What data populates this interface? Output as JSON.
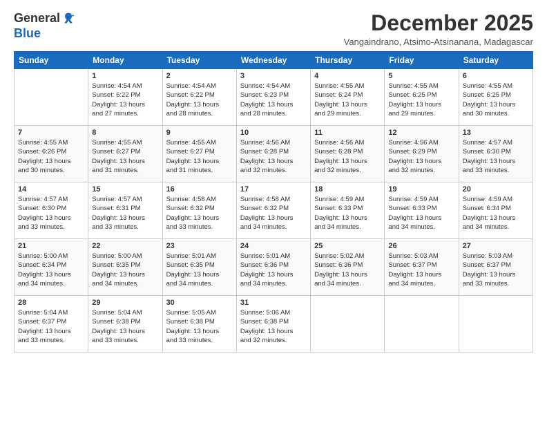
{
  "header": {
    "logo_line1": "General",
    "logo_line2": "Blue",
    "month": "December 2025",
    "location": "Vangaindrano, Atsimo-Atsinanana, Madagascar"
  },
  "days_of_week": [
    "Sunday",
    "Monday",
    "Tuesday",
    "Wednesday",
    "Thursday",
    "Friday",
    "Saturday"
  ],
  "weeks": [
    [
      {
        "num": "",
        "detail": ""
      },
      {
        "num": "1",
        "detail": "Sunrise: 4:54 AM\nSunset: 6:22 PM\nDaylight: 13 hours\nand 27 minutes."
      },
      {
        "num": "2",
        "detail": "Sunrise: 4:54 AM\nSunset: 6:22 PM\nDaylight: 13 hours\nand 28 minutes."
      },
      {
        "num": "3",
        "detail": "Sunrise: 4:54 AM\nSunset: 6:23 PM\nDaylight: 13 hours\nand 28 minutes."
      },
      {
        "num": "4",
        "detail": "Sunrise: 4:55 AM\nSunset: 6:24 PM\nDaylight: 13 hours\nand 29 minutes."
      },
      {
        "num": "5",
        "detail": "Sunrise: 4:55 AM\nSunset: 6:25 PM\nDaylight: 13 hours\nand 29 minutes."
      },
      {
        "num": "6",
        "detail": "Sunrise: 4:55 AM\nSunset: 6:25 PM\nDaylight: 13 hours\nand 30 minutes."
      }
    ],
    [
      {
        "num": "7",
        "detail": "Sunrise: 4:55 AM\nSunset: 6:26 PM\nDaylight: 13 hours\nand 30 minutes."
      },
      {
        "num": "8",
        "detail": "Sunrise: 4:55 AM\nSunset: 6:27 PM\nDaylight: 13 hours\nand 31 minutes."
      },
      {
        "num": "9",
        "detail": "Sunrise: 4:55 AM\nSunset: 6:27 PM\nDaylight: 13 hours\nand 31 minutes."
      },
      {
        "num": "10",
        "detail": "Sunrise: 4:56 AM\nSunset: 6:28 PM\nDaylight: 13 hours\nand 32 minutes."
      },
      {
        "num": "11",
        "detail": "Sunrise: 4:56 AM\nSunset: 6:28 PM\nDaylight: 13 hours\nand 32 minutes."
      },
      {
        "num": "12",
        "detail": "Sunrise: 4:56 AM\nSunset: 6:29 PM\nDaylight: 13 hours\nand 32 minutes."
      },
      {
        "num": "13",
        "detail": "Sunrise: 4:57 AM\nSunset: 6:30 PM\nDaylight: 13 hours\nand 33 minutes."
      }
    ],
    [
      {
        "num": "14",
        "detail": "Sunrise: 4:57 AM\nSunset: 6:30 PM\nDaylight: 13 hours\nand 33 minutes."
      },
      {
        "num": "15",
        "detail": "Sunrise: 4:57 AM\nSunset: 6:31 PM\nDaylight: 13 hours\nand 33 minutes."
      },
      {
        "num": "16",
        "detail": "Sunrise: 4:58 AM\nSunset: 6:32 PM\nDaylight: 13 hours\nand 33 minutes."
      },
      {
        "num": "17",
        "detail": "Sunrise: 4:58 AM\nSunset: 6:32 PM\nDaylight: 13 hours\nand 34 minutes."
      },
      {
        "num": "18",
        "detail": "Sunrise: 4:59 AM\nSunset: 6:33 PM\nDaylight: 13 hours\nand 34 minutes."
      },
      {
        "num": "19",
        "detail": "Sunrise: 4:59 AM\nSunset: 6:33 PM\nDaylight: 13 hours\nand 34 minutes."
      },
      {
        "num": "20",
        "detail": "Sunrise: 4:59 AM\nSunset: 6:34 PM\nDaylight: 13 hours\nand 34 minutes."
      }
    ],
    [
      {
        "num": "21",
        "detail": "Sunrise: 5:00 AM\nSunset: 6:34 PM\nDaylight: 13 hours\nand 34 minutes."
      },
      {
        "num": "22",
        "detail": "Sunrise: 5:00 AM\nSunset: 6:35 PM\nDaylight: 13 hours\nand 34 minutes."
      },
      {
        "num": "23",
        "detail": "Sunrise: 5:01 AM\nSunset: 6:35 PM\nDaylight: 13 hours\nand 34 minutes."
      },
      {
        "num": "24",
        "detail": "Sunrise: 5:01 AM\nSunset: 6:36 PM\nDaylight: 13 hours\nand 34 minutes."
      },
      {
        "num": "25",
        "detail": "Sunrise: 5:02 AM\nSunset: 6:36 PM\nDaylight: 13 hours\nand 34 minutes."
      },
      {
        "num": "26",
        "detail": "Sunrise: 5:03 AM\nSunset: 6:37 PM\nDaylight: 13 hours\nand 34 minutes."
      },
      {
        "num": "27",
        "detail": "Sunrise: 5:03 AM\nSunset: 6:37 PM\nDaylight: 13 hours\nand 33 minutes."
      }
    ],
    [
      {
        "num": "28",
        "detail": "Sunrise: 5:04 AM\nSunset: 6:37 PM\nDaylight: 13 hours\nand 33 minutes."
      },
      {
        "num": "29",
        "detail": "Sunrise: 5:04 AM\nSunset: 6:38 PM\nDaylight: 13 hours\nand 33 minutes."
      },
      {
        "num": "30",
        "detail": "Sunrise: 5:05 AM\nSunset: 6:38 PM\nDaylight: 13 hours\nand 33 minutes."
      },
      {
        "num": "31",
        "detail": "Sunrise: 5:06 AM\nSunset: 6:38 PM\nDaylight: 13 hours\nand 32 minutes."
      },
      {
        "num": "",
        "detail": ""
      },
      {
        "num": "",
        "detail": ""
      },
      {
        "num": "",
        "detail": ""
      }
    ]
  ]
}
